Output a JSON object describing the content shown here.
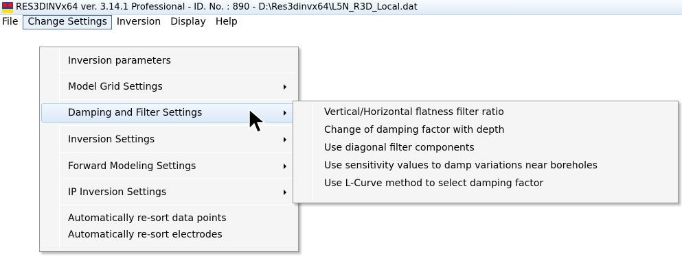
{
  "window": {
    "title": "RES3DINVx64 ver. 3.14.1 Professional - ID. No. : 890  - D:\\Res3dinvx64\\L5N_R3D_Local.dat"
  },
  "menubar": {
    "items": [
      {
        "label": "File"
      },
      {
        "label": "Change Settings"
      },
      {
        "label": "Inversion"
      },
      {
        "label": "Display"
      },
      {
        "label": "Help"
      }
    ]
  },
  "change_settings_menu": {
    "items": [
      {
        "label": "Inversion parameters",
        "has_submenu": false
      },
      {
        "label": "Model Grid Settings",
        "has_submenu": true
      },
      {
        "label": "Damping and Filter Settings",
        "has_submenu": true,
        "highlighted": true
      },
      {
        "label": "Inversion Settings",
        "has_submenu": true
      },
      {
        "label": "Forward Modeling Settings",
        "has_submenu": true
      },
      {
        "label": "IP Inversion Settings",
        "has_submenu": true
      },
      {
        "label": "Automatically re-sort data points",
        "has_submenu": false
      },
      {
        "label": "Automatically re-sort electrodes",
        "has_submenu": false
      }
    ]
  },
  "damping_submenu": {
    "items": [
      {
        "label": "Vertical/Horizontal flatness filter ratio"
      },
      {
        "label": "Change of damping factor with depth"
      },
      {
        "label": "Use diagonal filter components"
      },
      {
        "label": "Use sensitivity values to damp variations near boreholes"
      },
      {
        "label": "Use L-Curve method to select damping factor"
      }
    ]
  },
  "colors": {
    "title_bar": "#dfeaf6",
    "menu_background": "#f5f5f5",
    "highlight_border": "#a8c8ec",
    "highlight_fill": "#dbe9f9"
  }
}
